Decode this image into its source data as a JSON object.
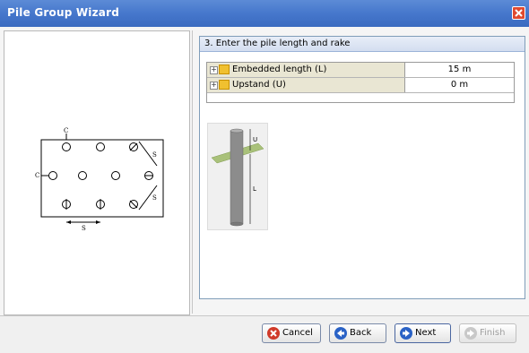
{
  "window": {
    "title": "Pile Group Wizard"
  },
  "step": {
    "header": "3. Enter the pile length and rake"
  },
  "properties": [
    {
      "label": "Embedded length (L)",
      "value": "15 m"
    },
    {
      "label": "Upstand (U)",
      "value": "0 m"
    }
  ],
  "layout_diagram": {
    "labels": {
      "c_top": "C",
      "c_left": "C",
      "s_spacing": "S"
    }
  },
  "pile_diagram": {
    "labels": {
      "upstand": "U",
      "length": "L"
    }
  },
  "buttons": {
    "cancel": "Cancel",
    "back": "Back",
    "next": "Next",
    "finish": "Finish"
  },
  "colors": {
    "titlebar": "#4677cc",
    "close": "#e04a2f",
    "cancel_icon": "#d03a2a",
    "nav_icon": "#2a62c6",
    "ground_plane": "#a9c17a",
    "pile": "#8c8c8c"
  }
}
